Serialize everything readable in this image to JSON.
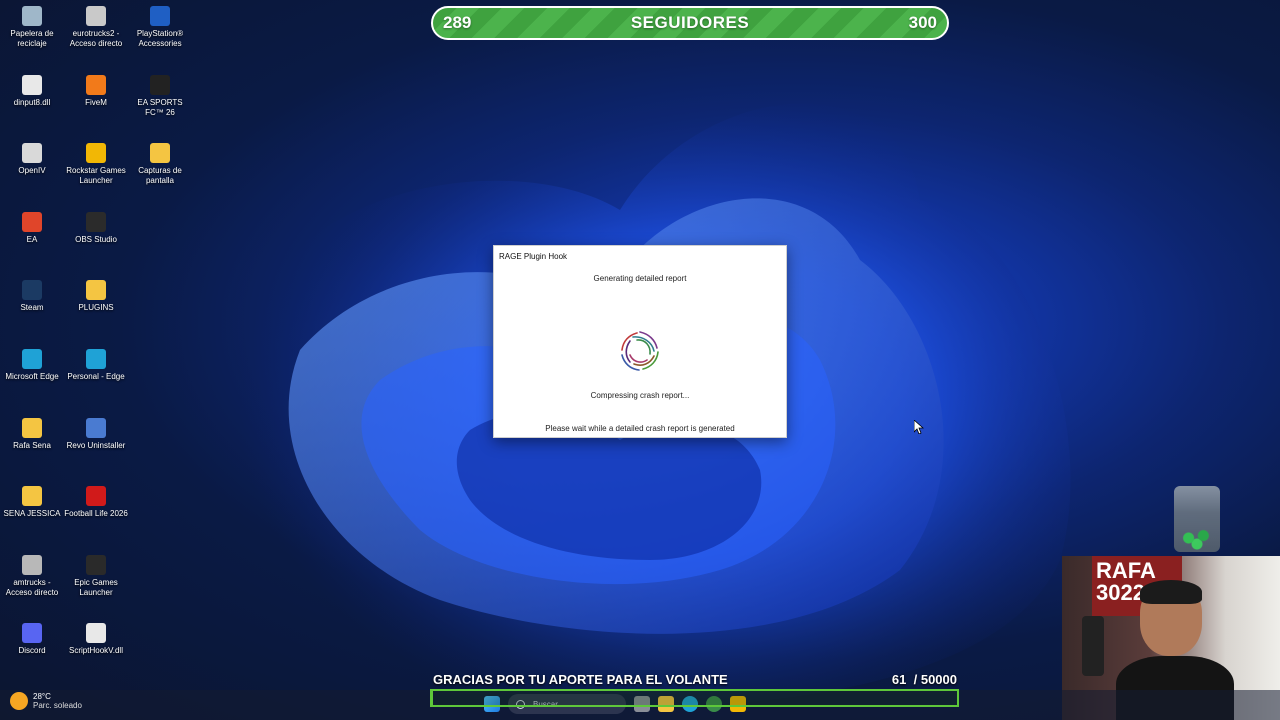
{
  "desktop_icons": [
    {
      "label": "Papelera de reciclaje",
      "icon": "recycle-bin-icon",
      "color": "#9fb7c9"
    },
    {
      "label": "eurotrucks2 - Acceso directo",
      "icon": "truck-icon",
      "color": "#c9c9c9"
    },
    {
      "label": "PlayStation® Accessories",
      "icon": "playstation-icon",
      "color": "#1f5fc4"
    },
    {
      "label": "dinput8.dll",
      "icon": "file-icon",
      "color": "#e8e8e8"
    },
    {
      "label": "FiveM",
      "icon": "fivem-icon",
      "color": "#f27a1a"
    },
    {
      "label": "EA SPORTS FC™ 26",
      "icon": "ea-fc-icon",
      "color": "#222222"
    },
    {
      "label": "OpenIV",
      "icon": "openiv-icon",
      "color": "#d9d9d9"
    },
    {
      "label": "Rockstar Games Launcher",
      "icon": "rockstar-icon",
      "color": "#f2b705"
    },
    {
      "label": "Capturas de pantalla",
      "icon": "folder-icon",
      "color": "#f4c542"
    },
    {
      "label": "EA",
      "icon": "ea-icon",
      "color": "#e0452a"
    },
    {
      "label": "OBS Studio",
      "icon": "obs-icon",
      "color": "#2b2b2b"
    },
    {
      "label": "Steam",
      "icon": "steam-icon",
      "color": "#1b3a63"
    },
    {
      "label": "PLUGINS",
      "icon": "folder-icon",
      "color": "#f4c542"
    },
    {
      "label": "Microsoft Edge",
      "icon": "edge-icon",
      "color": "#1fa2d6"
    },
    {
      "label": "Personal - Edge",
      "icon": "edge-icon",
      "color": "#1fa2d6"
    },
    {
      "label": "Rafa Sena",
      "icon": "folder-icon",
      "color": "#f4c542"
    },
    {
      "label": "Revo Uninstaller",
      "icon": "revo-icon",
      "color": "#4a7bd1"
    },
    {
      "label": "SENA JESSICA",
      "icon": "folder-icon",
      "color": "#f4c542"
    },
    {
      "label": "Football Life 2026",
      "icon": "football-life-icon",
      "color": "#d11a1a"
    },
    {
      "label": "amtrucks - Acceso directo",
      "icon": "truck-icon",
      "color": "#b8b8b8"
    },
    {
      "label": "Epic Games Launcher",
      "icon": "epic-icon",
      "color": "#2a2a2a"
    },
    {
      "label": "Discord",
      "icon": "discord-icon",
      "color": "#5865f2"
    },
    {
      "label": "ScriptHookV.dll",
      "icon": "file-icon",
      "color": "#e8e8e8"
    }
  ],
  "followers": {
    "current": "289",
    "label": "SEGUIDORES",
    "goal": "300"
  },
  "dialog": {
    "title": "RAGE Plugin Hook",
    "heading": "Generating detailed report",
    "status": "Compressing crash report...",
    "footer": "Please wait while a detailed crash report is generated"
  },
  "donation": {
    "label": "GRACIAS POR TU APORTE PARA EL VOLANTE",
    "current": "61",
    "goal": "/ 50000",
    "progress_fraction": 0.0012
  },
  "taskbar": {
    "weather_temp": "28°C",
    "weather_desc": "Parc. soleado",
    "search_placeholder": "Buscar"
  },
  "webcam": {
    "poster_text": "RAFA 30229"
  },
  "colors": {
    "follow_bar_green": "#4cb34c",
    "goal_green": "#5ec83a",
    "wallpaper_blue": "#1e4fd8"
  }
}
